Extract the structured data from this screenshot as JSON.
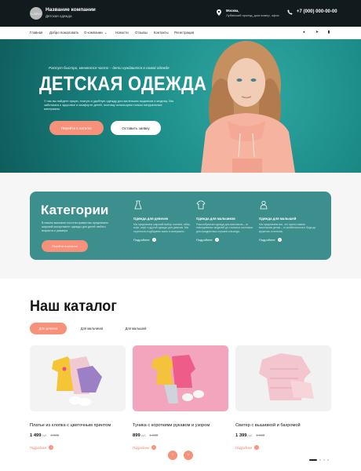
{
  "colors": {
    "accent": "#f7917a",
    "teal": "#3c8f8d",
    "dark": "#111a1c"
  },
  "header": {
    "logo_text": "LOGO",
    "company_name": "Название компании",
    "company_sub": "Детская одежда",
    "address_city": "Москва,",
    "address_line": "Лубянский проезд, дом номер, офис",
    "phone": "+7 (000) 000-00-00"
  },
  "nav": {
    "items": [
      "Главная",
      "Добро пожаловать",
      "О компании",
      "Новости",
      "Отзывы",
      "Контакты",
      "Регистрация"
    ],
    "icons": [
      "vk-icon",
      "telegram-icon",
      "phone-small-icon"
    ]
  },
  "hero": {
    "tagline": "Растут быстро, меняются часто – дети нуждаются в новой одежде",
    "title": "ДЕТСКАЯ ОДЕЖДА",
    "text": "У нас вы найдете яркую, эпатую и удобную одежду для маленьких модников и модниц. Мы заботимся о здоровье и комфорте детей, поэтому используем только натуральные материалы.",
    "btn_catalog": "Перейти в каталог",
    "btn_request": "Оставить заявку"
  },
  "categories": {
    "title": "Категории",
    "description": "В нашем магазине-постели правил вы предлагаем широкий ассортимент одежды для детей любого возраста и размера",
    "button": "Перейти в каталог",
    "items": [
      {
        "name": "Одежда для девочек",
        "text": "Мы предлагаем широкий выбор платьев, юбок, кофт, шорт и другой одежды для девочек. Мы тщательно подбираем ткани и материалы.",
        "more": "Подробнее",
        "icon": "dress-icon"
      },
      {
        "name": "Одежда для мальчиков",
        "text": "Разнообразная одежда для мальчиков – от повседневных моделей до стильных костюмов для праздничных случаев и выхода.",
        "more": "Подробнее",
        "icon": "shirt-icon"
      },
      {
        "name": "Одежда для малышей",
        "text": "Мы предлагаем все, что нужно самым маленьким детям – от комбинезонов и боди до кружечек и пеленок.",
        "more": "Подробнее",
        "icon": "baby-icon"
      }
    ]
  },
  "catalog": {
    "title": "Наш каталог",
    "tabs": [
      "Для девочек",
      "Для мальчиков",
      "Для малышей"
    ],
    "currency": "руб.",
    "products": [
      {
        "name": "Платье из хлопка с цветочным принтом",
        "price": "1 499",
        "old_price": "2 000",
        "more": "Подробнее"
      },
      {
        "name": "Туника с короткими рукавом и узором",
        "price": "899",
        "old_price": "1 000",
        "more": "Подробнее"
      },
      {
        "name": "Свитер с вышивкой и бахромой",
        "price": "1 399",
        "old_price": "1 500",
        "more": "Подробнее"
      }
    ],
    "prev": "‹",
    "next": "›"
  }
}
